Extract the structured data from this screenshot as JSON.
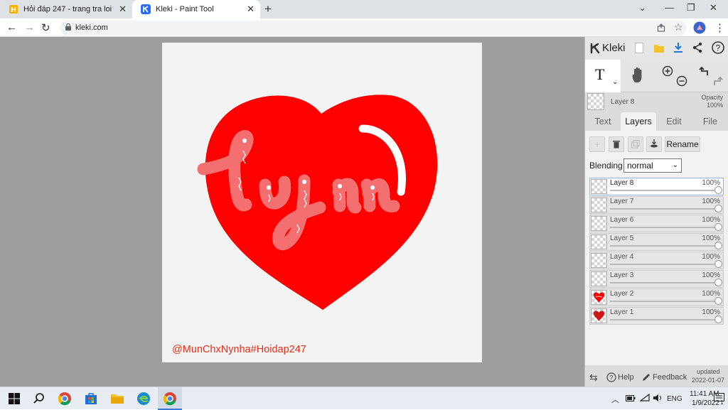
{
  "browser": {
    "tabs": [
      {
        "title": "Hỏi đáp 247 - trang tra loi",
        "active": false
      },
      {
        "title": "Kleki - Paint Tool",
        "active": true
      }
    ],
    "new_tab": "+",
    "address": "kleki.com"
  },
  "canvas": {
    "watermark": "@MunChxNynha#Hoidap247",
    "heart_color": "#ff0000",
    "letter_color": "#f46e6e"
  },
  "panel": {
    "logo": "Kleki",
    "current_layer": {
      "name": "Layer 8",
      "opacity_label": "Opacity",
      "opacity_value": "100%"
    },
    "tabs": [
      "Text",
      "Layers",
      "Edit",
      "File"
    ],
    "active_tab": "Layers",
    "rename_label": "Rename",
    "blending_label": "Blending",
    "blending_value": "normal",
    "layers": [
      {
        "name": "Layer 8",
        "opacity": "100%"
      },
      {
        "name": "Layer 7",
        "opacity": "100%"
      },
      {
        "name": "Layer 6",
        "opacity": "100%"
      },
      {
        "name": "Layer 5",
        "opacity": "100%"
      },
      {
        "name": "Layer 4",
        "opacity": "100%"
      },
      {
        "name": "Layer 3",
        "opacity": "100%"
      },
      {
        "name": "Layer 2",
        "opacity": "100%"
      },
      {
        "name": "Layer 1",
        "opacity": "100%"
      }
    ],
    "footer": {
      "help": "Help",
      "feedback": "Feedback",
      "updated_label": "updated",
      "updated_date": "2022-01-07"
    }
  },
  "taskbar": {
    "language": "ENG",
    "time": "11:41 AM",
    "date": "1/9/2022",
    "notification_count": "1"
  }
}
